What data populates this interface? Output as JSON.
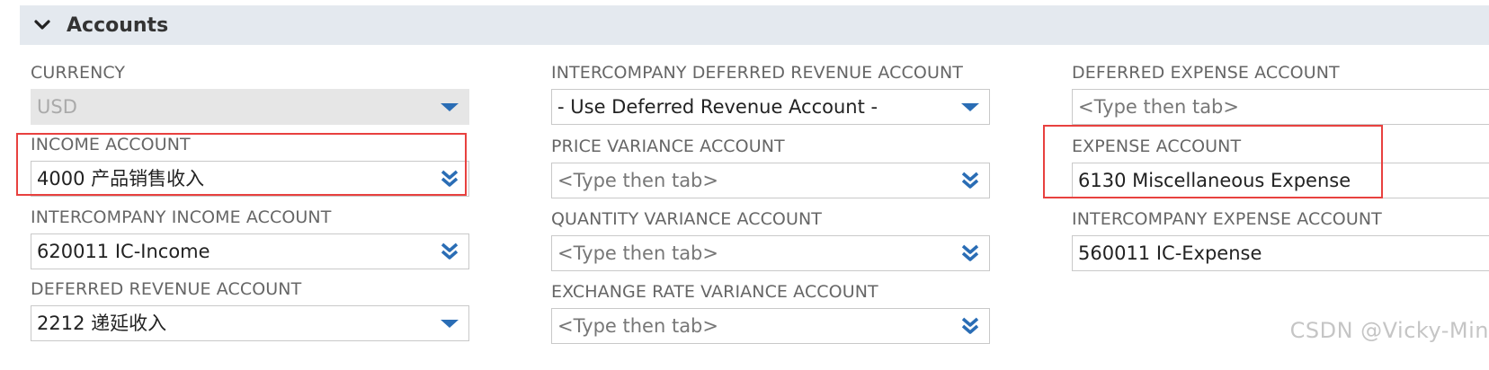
{
  "section": {
    "title": "Accounts"
  },
  "fields": {
    "currency": {
      "label": "CURRENCY",
      "value": "USD"
    },
    "income_account": {
      "label": "INCOME ACCOUNT",
      "value": "4000 产品销售收入"
    },
    "intercompany_income_account": {
      "label": "INTERCOMPANY INCOME ACCOUNT",
      "value": "620011 IC-Income"
    },
    "deferred_revenue_account": {
      "label": "DEFERRED REVENUE ACCOUNT",
      "value": "2212 递延收入"
    },
    "intercompany_deferred_revenue_account": {
      "label": "INTERCOMPANY DEFERRED REVENUE ACCOUNT",
      "value": "- Use Deferred Revenue Account -"
    },
    "price_variance_account": {
      "label": "PRICE VARIANCE ACCOUNT",
      "placeholder": "<Type then tab>"
    },
    "quantity_variance_account": {
      "label": "QUANTITY VARIANCE ACCOUNT",
      "placeholder": "<Type then tab>"
    },
    "exchange_rate_variance_account": {
      "label": "EXCHANGE RATE VARIANCE ACCOUNT",
      "placeholder": "<Type then tab>"
    },
    "deferred_expense_account": {
      "label": "DEFERRED EXPENSE ACCOUNT",
      "placeholder": "<Type then tab>"
    },
    "expense_account": {
      "label": "EXPENSE ACCOUNT",
      "value": "6130 Miscellaneous Expense"
    },
    "intercompany_expense_account": {
      "label": "INTERCOMPANY EXPENSE ACCOUNT",
      "value": "560011 IC-Expense"
    }
  },
  "watermark": "CSDN @Vicky-Min",
  "colors": {
    "header_bg": "#e4e9ef",
    "icon_blue": "#2a6db5",
    "highlight_red": "#e8413f",
    "disabled_bg": "#e6e6e6"
  },
  "icons": {
    "section_toggle": "chevron-down-icon",
    "dropdown": "caret-down-icon",
    "popup_list": "double-chevron-down-icon"
  }
}
